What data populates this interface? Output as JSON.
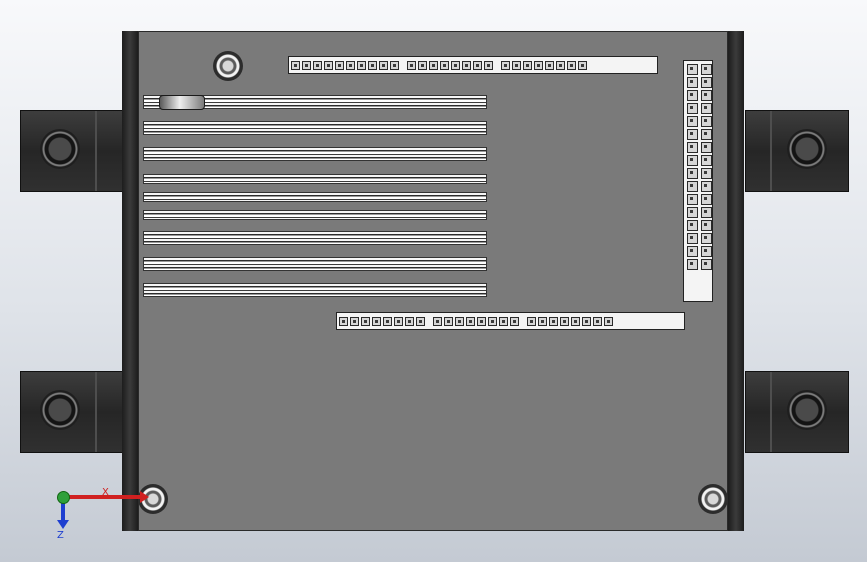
{
  "viewport": {
    "background": "#dfe3e9",
    "enclosure_color": "#7a7a7a",
    "frame_color": "#1d1d1d",
    "header_rows": [
      {
        "id": "top",
        "groups": [
          10,
          8,
          8
        ]
      },
      {
        "id": "bottom",
        "groups": [
          8,
          8,
          8
        ]
      }
    ],
    "vertical_header_pins": 32,
    "slot_count": 9
  },
  "triad": {
    "x_label": "X",
    "y_label": "",
    "z_label": "Z",
    "x_color": "#d02020",
    "y_color": "#2fa03a",
    "z_color": "#1e3fd0"
  }
}
